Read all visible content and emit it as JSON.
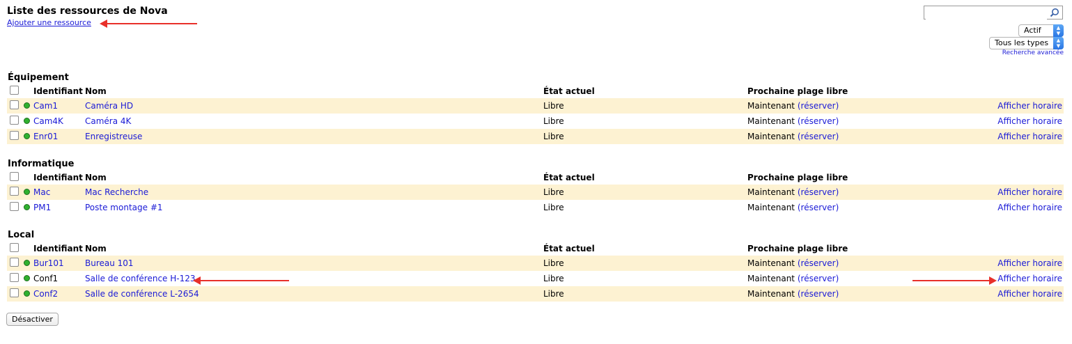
{
  "header": {
    "title": "Liste des ressources de Nova",
    "add_link": "Ajouter une ressource"
  },
  "search": {
    "value": "",
    "placeholder": "",
    "icon": "magnifier-icon"
  },
  "filters": {
    "status": "Actif",
    "type": "Tous les types",
    "advanced_link": "Recherche avancée"
  },
  "columns": {
    "id": "Identifiant",
    "nom": "Nom",
    "etat": "État actuel",
    "plage": "Prochaine plage libre"
  },
  "sections": [
    {
      "title": "Équipement",
      "rows": [
        {
          "id": "Cam1",
          "nom": "Caméra HD",
          "etat": "Libre",
          "plage": "Maintenant",
          "reserve": "(réserver)",
          "afficher": "Afficher horaire"
        },
        {
          "id": "Cam4K",
          "nom": "Caméra 4K",
          "etat": "Libre",
          "plage": "Maintenant",
          "reserve": "(réserver)",
          "afficher": "Afficher horaire"
        },
        {
          "id": "Enr01",
          "nom": "Enregistreuse",
          "etat": "Libre",
          "plage": "Maintenant",
          "reserve": "(réserver)",
          "afficher": "Afficher horaire"
        }
      ]
    },
    {
      "title": "Informatique",
      "rows": [
        {
          "id": "Mac",
          "nom": "Mac Recherche",
          "etat": "Libre",
          "plage": "Maintenant",
          "reserve": "(réserver)",
          "afficher": "Afficher horaire"
        },
        {
          "id": "PM1",
          "nom": "Poste montage #1",
          "etat": "Libre",
          "plage": "Maintenant",
          "reserve": "(réserver)",
          "afficher": "Afficher horaire"
        }
      ]
    },
    {
      "title": "Local",
      "rows": [
        {
          "id": "Bur101",
          "nom": "Bureau 101",
          "etat": "Libre",
          "plage": "Maintenant",
          "reserve": "(réserver)",
          "afficher": "Afficher horaire"
        },
        {
          "id": "Conf1",
          "nom": "Salle de conférence H-123",
          "etat": "Libre",
          "plage": "Maintenant",
          "reserve": "(réserver)",
          "afficher": "Afficher horaire"
        },
        {
          "id": "Conf2",
          "nom": "Salle de conférence L-2654",
          "etat": "Libre",
          "plage": "Maintenant",
          "reserve": "(réserver)",
          "afficher": "Afficher horaire"
        }
      ]
    }
  ],
  "actions": {
    "deactivate": "Désactiver"
  },
  "colors": {
    "link": "#1a1ad6",
    "row_alt": "#fdf2d2",
    "status_dot": "#2fb12f",
    "annotation": "#e8302a"
  }
}
